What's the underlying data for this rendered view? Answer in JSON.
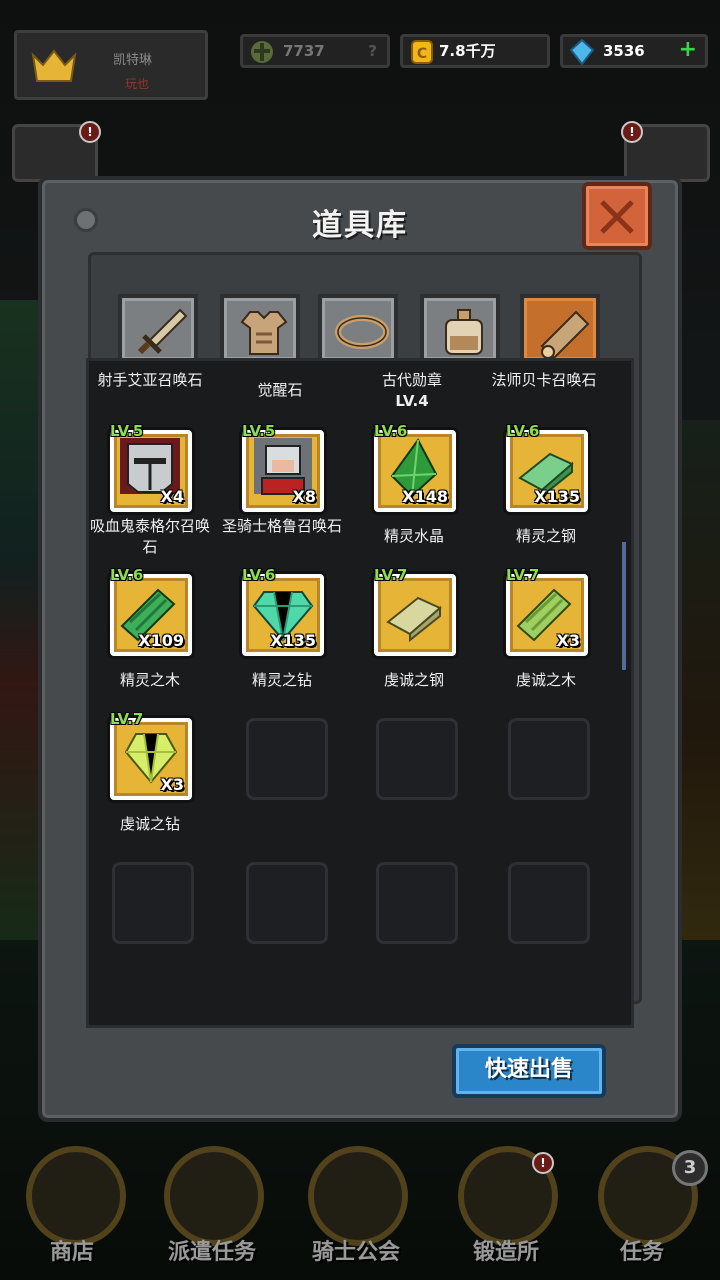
{
  "hud": {
    "profile_name": "凯特琳",
    "profile_sub": "玩也",
    "power": "7737",
    "power_hint": "?",
    "gold": "7.8千万",
    "gems": "3536",
    "gems_plus": "+"
  },
  "alerts": {
    "left": "!",
    "right": "!"
  },
  "modal": {
    "title": "道具库",
    "sell_button": "快速出售"
  },
  "tabs": [
    {
      "icon": "sword-icon"
    },
    {
      "icon": "armor-icon"
    },
    {
      "icon": "ring-icon"
    },
    {
      "icon": "potion-icon"
    },
    {
      "icon": "material-icon",
      "active": true
    }
  ],
  "top_row": [
    {
      "name": "射手艾亚召唤石",
      "sub": ""
    },
    {
      "name": "觉醒石",
      "sub": ""
    },
    {
      "name": "古代勋章",
      "sub": "LV.4"
    },
    {
      "name": "法师贝卡召唤石",
      "sub": ""
    }
  ],
  "items": [
    {
      "level": "LV.5",
      "qty": "X4",
      "name": "吸血鬼泰格尔召唤石",
      "icon": "vampire-helmet-icon"
    },
    {
      "level": "LV.5",
      "qty": "X8",
      "name": "圣骑士格鲁召唤石",
      "icon": "paladin-icon"
    },
    {
      "level": "LV.6",
      "qty": "X148",
      "name": "精灵水晶",
      "icon": "green-crystal-icon"
    },
    {
      "level": "LV.6",
      "qty": "X135",
      "name": "精灵之钢",
      "icon": "green-ingot-icon"
    },
    {
      "level": "LV.6",
      "qty": "X109",
      "name": "精灵之木",
      "icon": "green-wood-icon"
    },
    {
      "level": "LV.6",
      "qty": "X135",
      "name": "精灵之钻",
      "icon": "green-diamond-icon"
    },
    {
      "level": "LV.7",
      "qty": "",
      "name": "虔诚之钢",
      "icon": "pale-ingot-icon"
    },
    {
      "level": "LV.7",
      "qty": "X3",
      "name": "虔诚之木",
      "icon": "pale-wood-icon"
    },
    {
      "level": "LV.7",
      "qty": "X3",
      "name": "虔诚之钻",
      "icon": "pale-diamond-icon"
    }
  ],
  "nav": [
    {
      "label": "商店",
      "icon": "shop-icon"
    },
    {
      "label": "派遣任务",
      "icon": "dispatch-icon"
    },
    {
      "label": "骑士公会",
      "icon": "vip-knight-icon"
    },
    {
      "label": "锻造所",
      "icon": "forge-icon",
      "alert": "!"
    },
    {
      "label": "任务",
      "icon": "quest-icon",
      "badge": "3"
    }
  ],
  "colors": {
    "slot_gold": "#e6b437",
    "level_green": "#8be04a",
    "sell_blue": "#2a86c9",
    "close_orange": "#d2633a",
    "active_tab": "#c56f2c"
  }
}
